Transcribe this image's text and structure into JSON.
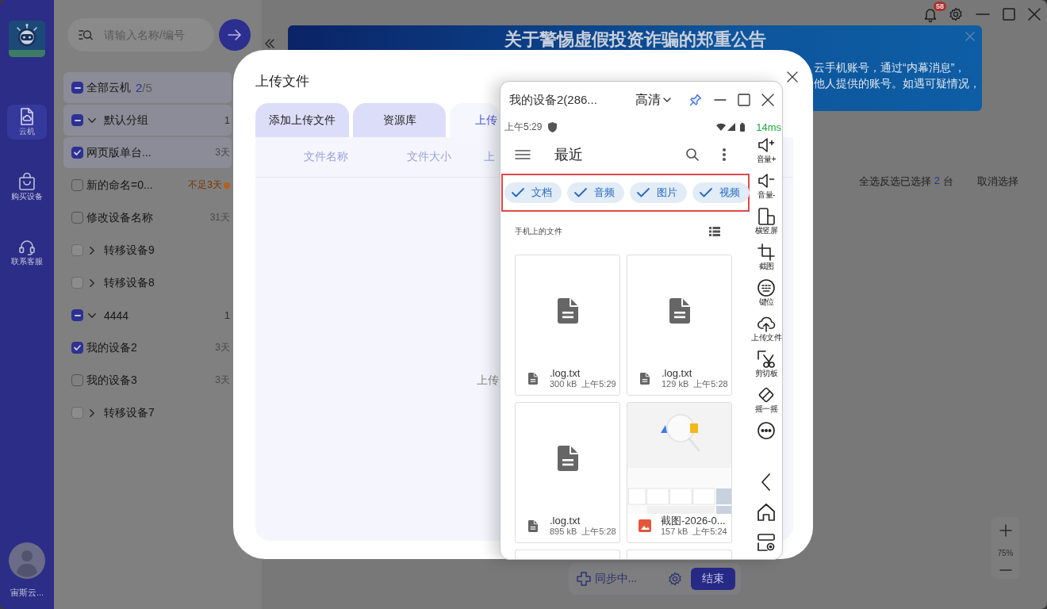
{
  "sidebar": {
    "nav_items": [
      {
        "kind": "cloud",
        "label": "云机",
        "selected": true
      },
      {
        "kind": "shop",
        "label": "购买设备",
        "selected": false
      },
      {
        "kind": "support",
        "label": "联系客服",
        "selected": false
      }
    ],
    "user_name": "宙斯云..."
  },
  "device_list": {
    "search": {
      "placeholder": "请输入名称/编号"
    },
    "all_devices": {
      "label": "全部云机",
      "checked_count": "2",
      "total": "/5",
      "checked": false,
      "indeterminate": true,
      "selected": true
    },
    "groups": [
      {
        "label": "默认分组",
        "count": "1",
        "checked": false,
        "indeterminate": true,
        "disabled": false,
        "expanded": true,
        "selected": true,
        "children": [
          {
            "label": "网页版单台...",
            "remaining": "3天",
            "warning": false,
            "checked": true,
            "disabled": false,
            "selected": true
          },
          {
            "label": "新的命名=0...",
            "remaining": "不足3天",
            "warning": true,
            "checked": false,
            "disabled": false,
            "selected": false
          },
          {
            "label": "修改设备名称",
            "remaining": "31天",
            "warning": false,
            "checked": false,
            "disabled": false,
            "selected": false
          }
        ]
      },
      {
        "label": "转移设备9",
        "checked": false,
        "indeterminate": false,
        "disabled": true,
        "expanded": false,
        "selected": false
      },
      {
        "label": "转移设备8",
        "checked": false,
        "indeterminate": false,
        "disabled": true,
        "expanded": false,
        "selected": false
      },
      {
        "label": "4444",
        "count": "1",
        "checked": false,
        "indeterminate": true,
        "disabled": false,
        "expanded": true,
        "selected": false,
        "children": [
          {
            "label": "我的设备2",
            "remaining": "3天",
            "warning": false,
            "checked": true,
            "disabled": false,
            "selected": false
          },
          {
            "label": "我的设备3",
            "remaining": "3天",
            "warning": false,
            "checked": false,
            "disabled": false,
            "selected": false
          }
        ]
      },
      {
        "label": "转移设备7",
        "checked": false,
        "indeterminate": false,
        "disabled": true,
        "expanded": false,
        "selected": false
      }
    ]
  },
  "main": {
    "notifications": {
      "badge": "58"
    },
    "banner": {
      "title": "关于警惕虚假投资诈骗的郑重公告",
      "lines": [
        "云手机账号，通过“内幕消息”，",
        "他人提供的账号。如遇可疑情况，"
      ]
    },
    "selection_bar": {
      "select_all": "全选",
      "invert": "反选",
      "selected_prefix": "已选择",
      "selected_count": "2",
      "selected_suffix": "台",
      "clear": "取消选择"
    },
    "sync_bar": {
      "status": "同步中...",
      "end_button": "结束"
    },
    "zoom": {
      "level": "75%"
    }
  },
  "upload_dialog": {
    "title": "上传文件",
    "tabs": [
      {
        "label": "添加上传文件",
        "selected": false
      },
      {
        "label": "资源库",
        "selected": false
      },
      {
        "label": "上传",
        "selected": true
      }
    ],
    "columns": [
      "文件名称",
      "文件大小",
      "上"
    ],
    "empty_text": "上传"
  },
  "phone_window": {
    "title": "我的设备2(286...",
    "quality": "高清",
    "pinned": true,
    "status_bar": {
      "time": "上午5:29",
      "latency": "14ms"
    },
    "app_bar": {
      "title": "最近"
    },
    "filter_highlight": true,
    "filters": [
      {
        "label": "文档",
        "selected": true
      },
      {
        "label": "音频",
        "selected": true
      },
      {
        "label": "图片",
        "selected": true
      },
      {
        "label": "视频",
        "selected": true
      }
    ],
    "section_title": "手机上的文件",
    "files": [
      {
        "kind": "document",
        "name": ".log.txt",
        "size": "300 kB",
        "time": "上午5:29"
      },
      {
        "kind": "document",
        "name": ".log.txt",
        "size": "129 kB",
        "time": "上午5:28"
      },
      {
        "kind": "document",
        "name": ".log.txt",
        "size": "895 kB",
        "time": "上午5:28"
      },
      {
        "kind": "image",
        "name": "截图-2026-0...",
        "size": "157 kB",
        "time": "上午5:24"
      },
      {
        "kind": "partial"
      },
      {
        "kind": "partial"
      }
    ],
    "tools": [
      {
        "kind": "volup",
        "label": "音量+"
      },
      {
        "kind": "voldown",
        "label": "音量-"
      },
      {
        "kind": "rotate",
        "label": "横竖屏"
      },
      {
        "kind": "crop",
        "label": "截图"
      },
      {
        "kind": "keys",
        "label": "键位"
      },
      {
        "kind": "upload",
        "label": "上传文件"
      },
      {
        "kind": "clipboard",
        "label": "剪切板"
      },
      {
        "kind": "shake",
        "label": "摇一摇"
      },
      {
        "kind": "more"
      }
    ],
    "nav_keys": [
      {
        "kind": "back"
      },
      {
        "kind": "home"
      },
      {
        "kind": "recents"
      }
    ]
  }
}
